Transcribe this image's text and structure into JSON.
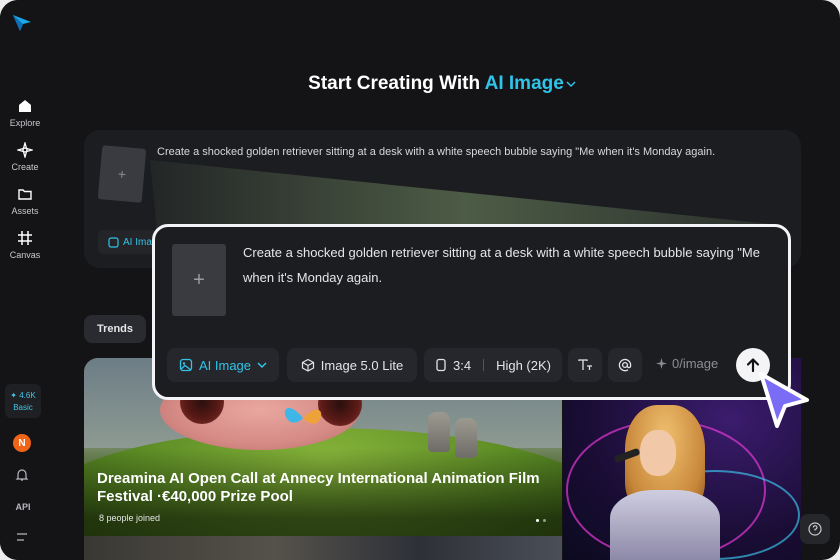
{
  "sidebar": {
    "items": [
      {
        "label": "Explore",
        "icon": "home-icon"
      },
      {
        "label": "Create",
        "icon": "sparkle-icon"
      },
      {
        "label": "Assets",
        "icon": "folder-icon"
      },
      {
        "label": "Canvas",
        "icon": "frame-icon"
      }
    ],
    "credits": "4.6K",
    "plan": "Basic",
    "avatar_initial": "N",
    "api_label": "API"
  },
  "headline": {
    "prefix": "Start Creating With",
    "mode": "AI Image"
  },
  "background_card": {
    "prompt": "Create a shocked golden retriever sitting at a desk with a white speech bubble saying \"Me when it's Monday again.",
    "mode_chip": "AI Ima"
  },
  "zoom_panel": {
    "prompt": "Create a shocked golden retriever sitting at a desk with a white speech bubble saying \"Me when it's Monday again.",
    "mode_button": "AI Image",
    "model_button": "Image 5.0 Lite",
    "ratio": "3:4",
    "quality": "High (2K)",
    "cost": "0/image"
  },
  "trends_tab": "Trends",
  "feature_card": {
    "title": "Dreamina AI Open Call at Annecy International Animation Film Festival ·€40,000 Prize Pool",
    "joined": "8 people joined"
  },
  "colors": {
    "accent": "#2fc4e8",
    "background": "#141417",
    "panel": "#1c1d21",
    "cursor": "#7b6cf6"
  }
}
